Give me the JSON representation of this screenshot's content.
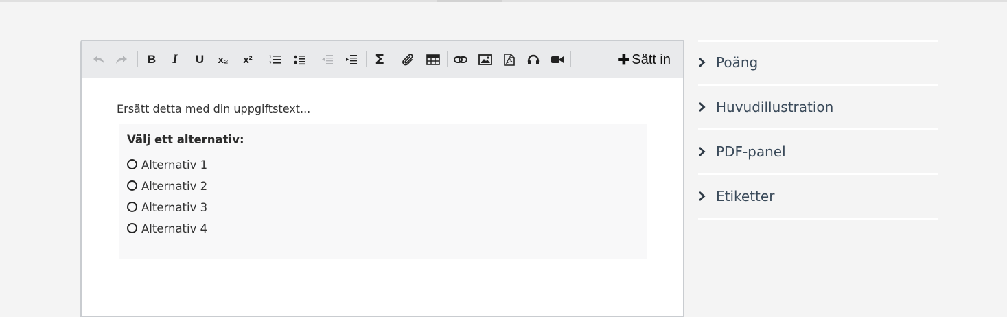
{
  "toolbar": {
    "buttons": [
      {
        "name": "undo-icon",
        "title": "undo"
      },
      {
        "name": "redo-icon",
        "title": "redo"
      },
      {
        "name": "bold-icon",
        "glyph": "B"
      },
      {
        "name": "italic-icon",
        "glyph": "I"
      },
      {
        "name": "underline-icon",
        "glyph": "U"
      },
      {
        "name": "subscript-icon",
        "glyph": "x₂"
      },
      {
        "name": "superscript-icon",
        "glyph": "x²"
      },
      {
        "name": "ordered-list-icon"
      },
      {
        "name": "bullet-list-icon"
      },
      {
        "name": "outdent-icon"
      },
      {
        "name": "indent-icon"
      },
      {
        "name": "sigma-icon",
        "glyph": "Σ"
      },
      {
        "name": "paperclip-icon"
      },
      {
        "name": "table-icon"
      },
      {
        "name": "link-icon"
      },
      {
        "name": "image-icon"
      },
      {
        "name": "pdf-icon"
      },
      {
        "name": "headphones-icon"
      },
      {
        "name": "video-camera-icon"
      }
    ],
    "insert_label": "Sätt in"
  },
  "editor": {
    "task_text": "Ersätt detta med din uppgiftstext...",
    "choice": {
      "title": "Välj ett alternativ:",
      "options": [
        "Alternativ 1",
        "Alternativ 2",
        "Alternativ 3",
        "Alternativ 4"
      ]
    }
  },
  "side_panel": {
    "items": [
      {
        "label": "Poäng"
      },
      {
        "label": "Huvudillustration"
      },
      {
        "label": "PDF-panel"
      },
      {
        "label": "Etiketter"
      }
    ]
  },
  "colors": {
    "background": "#f4f4f4",
    "toolbar": "#e9eaec",
    "editor_border": "#c9ccd0",
    "panel_text": "#3a4a5a"
  }
}
